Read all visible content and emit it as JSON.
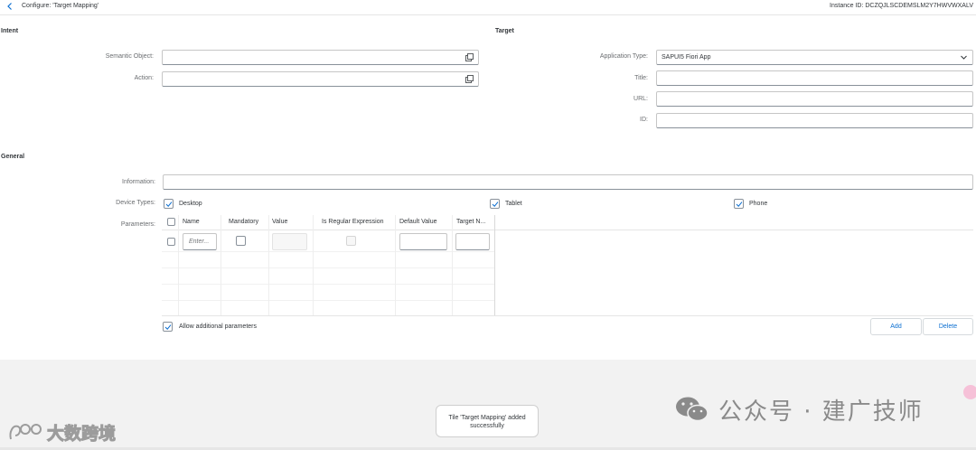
{
  "header": {
    "back_icon": "chevron-left-icon",
    "title": "Configure: 'Target Mapping'",
    "instance_id": "Instance ID: DCZQJLSCDEMSLM2Y7HWVWXALV"
  },
  "intent": {
    "section_title": "Intent",
    "semantic_object_label": "Semantic Object:",
    "semantic_object_value": "",
    "action_label": "Action:",
    "action_value": ""
  },
  "target": {
    "section_title": "Target",
    "application_type_label": "Application Type:",
    "application_type_value": "SAPUI5 Fiori App",
    "title_label": "Title:",
    "title_value": "",
    "url_label": "URL:",
    "url_value": "",
    "id_label": "ID:",
    "id_value": ""
  },
  "general": {
    "section_title": "General",
    "information_label": "Information:",
    "information_value": "",
    "device_types_label": "Device Types:",
    "devices": [
      {
        "label": "Desktop",
        "checked": true
      },
      {
        "label": "Tablet",
        "checked": true
      },
      {
        "label": "Phone",
        "checked": true
      }
    ],
    "parameters_label": "Parameters:"
  },
  "parameters_table": {
    "columns": [
      "Name",
      "Mandatory",
      "Value",
      "Is Regular Expression",
      "Default Value",
      "Target N..."
    ],
    "rows": [
      {
        "name_placeholder": "Enter...",
        "mandatory": false,
        "value": "",
        "is_regex": false,
        "default_value": "",
        "target_name": ""
      }
    ],
    "allow_additional_label": "Allow additional parameters",
    "allow_additional_checked": true,
    "add_label": "Add",
    "delete_label": "Delete"
  },
  "toast": {
    "message_line1": "Tile 'Target Mapping' added",
    "message_line2": "successfully"
  },
  "watermarks": {
    "right_text": "公众号 · 建广技师",
    "left_text": "大数跨境"
  },
  "colors": {
    "accent": "#0a6ed1",
    "text": "#32363a",
    "label": "#6a6d70",
    "footer_bg": "#f2f2f2"
  }
}
